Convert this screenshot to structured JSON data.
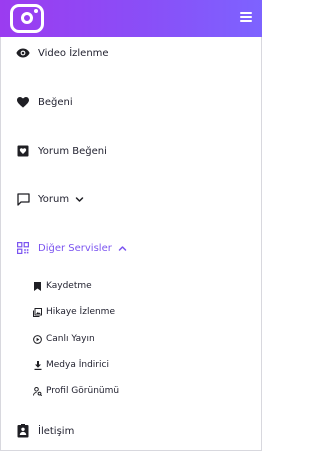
{
  "nav": {
    "video_views": {
      "label": "Video İzlenme",
      "icon": "eye-icon"
    },
    "likes": {
      "label": "Beğeni",
      "icon": "heart-icon"
    },
    "comment_likes": {
      "label": "Yorum Beğeni",
      "icon": "heart-message-icon"
    },
    "comments": {
      "label": "Yorum",
      "icon": "comment-icon"
    },
    "other_services": {
      "label": "Diğer Servisler",
      "icon": "grid-icon",
      "expanded": true,
      "color": "#7b54f0",
      "items": [
        {
          "label": "Kaydetme",
          "icon": "bookmark-icon"
        },
        {
          "label": "Hikaye İzlenme",
          "icon": "story-icon"
        },
        {
          "label": "Canlı Yayın",
          "icon": "play-circle-icon"
        },
        {
          "label": "Medya İndirici",
          "icon": "download-icon"
        },
        {
          "label": "Profil Görünümü",
          "icon": "profile-view-icon"
        }
      ]
    },
    "contact": {
      "label": "İletişim",
      "icon": "contact-icon"
    }
  },
  "colors": {
    "header_gradient_start": "#9b3cf0",
    "header_gradient_end": "#7d63ff",
    "accent": "#7b54f0",
    "text": "#222230"
  }
}
